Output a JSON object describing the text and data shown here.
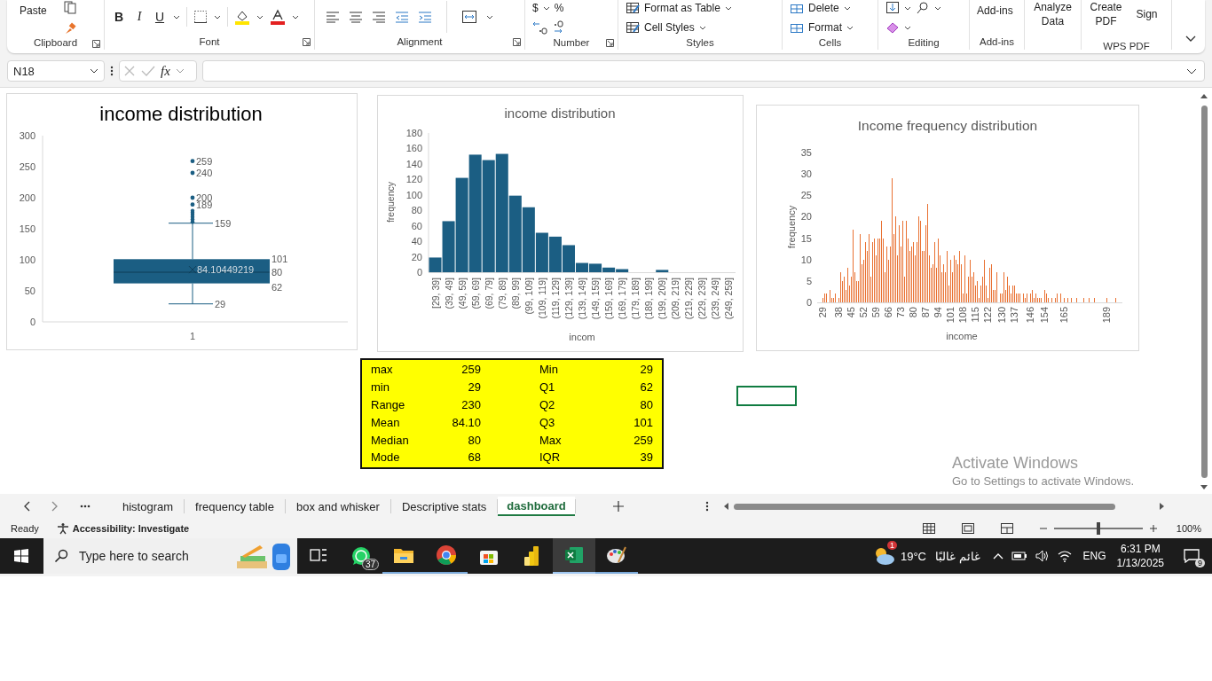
{
  "ribbon": {
    "clipboard": {
      "label": "Clipboard",
      "paste": "Paste"
    },
    "font": {
      "label": "Font",
      "bold": "B",
      "italic": "I",
      "underline": "U"
    },
    "alignment": {
      "label": "Alignment"
    },
    "number": {
      "label": "Number",
      "currency": "$",
      "percent": "%"
    },
    "styles": {
      "label": "Styles",
      "buttons": [
        "Format as Table",
        "Cell Styles"
      ]
    },
    "cells": {
      "label": "Cells",
      "buttons": [
        "Delete",
        "Format"
      ]
    },
    "editing": {
      "label": "Editing"
    },
    "addins": {
      "label": "Add-ins",
      "button": "Add-ins"
    },
    "analyze": {
      "button": "Analyze Data"
    },
    "wps": {
      "label": "WPS PDF",
      "buttons": [
        "Create PDF",
        "Sign"
      ]
    }
  },
  "formula_bar": {
    "name_box": "N18",
    "function_label": "fx"
  },
  "box_plot": {
    "title": "income distribution",
    "yticks": [
      "300",
      "250",
      "200",
      "150",
      "100",
      "50",
      "0"
    ],
    "category": "1",
    "min": "29",
    "q1": "62",
    "median": "80",
    "q3": "101",
    "upper_whisker": "159",
    "mean": "84.10449219",
    "outliers": [
      "259",
      "240",
      "200",
      "189"
    ]
  },
  "histogram": {
    "chart_data": {
      "type": "bar",
      "title": "income distribution",
      "xlabel": "incom",
      "ylabel": "frequency",
      "categories": [
        "[29, 39]",
        "(39, 49]",
        "(49, 59]",
        "(59, 69]",
        "(69, 79]",
        "(79, 89]",
        "(89, 99]",
        "(99, 109]",
        "(109, 119]",
        "(119, 129]",
        "(129, 139]",
        "(139, 149]",
        "(149, 159]",
        "(159, 169]",
        "(169, 179]",
        "(179, 189]",
        "(189, 199]",
        "(199, 209]",
        "(209, 219]",
        "(219, 229]",
        "(229, 239]",
        "(239, 249]",
        "(249, 259]"
      ],
      "series": [
        {
          "color": "#1b5e83",
          "values": [
            19,
            66,
            122,
            152,
            145,
            153,
            99,
            84,
            51,
            46,
            35,
            12,
            11,
            6,
            4,
            0,
            0,
            3,
            0,
            0,
            0,
            0,
            0
          ]
        }
      ],
      "ylim": [
        0,
        180
      ],
      "yticks": [
        0,
        20,
        40,
        60,
        80,
        100,
        120,
        140,
        160,
        180
      ]
    }
  },
  "frequency": {
    "chart_data": {
      "type": "bar",
      "title": "Income frequency distribution",
      "xlabel": "income",
      "ylabel": "frequency",
      "x": [
        29,
        30,
        31,
        33,
        34,
        35,
        36,
        38,
        39,
        40,
        41,
        42,
        43,
        44,
        45,
        46,
        47,
        48,
        49,
        50,
        51,
        52,
        53,
        54,
        55,
        56,
        57,
        58,
        59,
        60,
        61,
        62,
        63,
        64,
        65,
        66,
        67,
        68,
        69,
        70,
        71,
        72,
        73,
        74,
        75,
        76,
        77,
        78,
        79,
        80,
        81,
        82,
        83,
        84,
        85,
        86,
        87,
        88,
        89,
        90,
        91,
        92,
        93,
        94,
        95,
        96,
        97,
        98,
        99,
        100,
        101,
        102,
        103,
        104,
        105,
        106,
        107,
        108,
        109,
        110,
        111,
        112,
        113,
        114,
        115,
        116,
        117,
        118,
        119,
        120,
        121,
        122,
        123,
        124,
        125,
        126,
        127,
        129,
        130,
        131,
        132,
        133,
        134,
        135,
        136,
        137,
        138,
        139,
        140,
        142,
        143,
        144,
        146,
        147,
        148,
        149,
        150,
        151,
        152,
        154,
        155,
        156,
        158,
        160,
        161,
        163,
        165,
        167,
        169,
        172,
        176,
        179,
        182,
        189,
        194
      ],
      "xlim": [
        27,
        197
      ],
      "xticks": [
        29,
        38,
        45,
        52,
        59,
        66,
        73,
        80,
        87,
        94,
        101,
        108,
        115,
        122,
        130,
        137,
        146,
        154,
        165,
        189
      ],
      "series": [
        {
          "color": "#e97132",
          "values": [
            1,
            2,
            2,
            3,
            1,
            1,
            2,
            1,
            7,
            5,
            6,
            3,
            8,
            4,
            6,
            17,
            7,
            5,
            5,
            16,
            9,
            10,
            14,
            12,
            16,
            6,
            14,
            15,
            11,
            15,
            15,
            19,
            15,
            7,
            13,
            10,
            13,
            29,
            16,
            20,
            11,
            18,
            13,
            19,
            6,
            19,
            15,
            12,
            13,
            14,
            11,
            14,
            20,
            19,
            12,
            12,
            18,
            23,
            11,
            8,
            9,
            14,
            8,
            15,
            11,
            7,
            9,
            7,
            12,
            4,
            10,
            7,
            11,
            10,
            9,
            12,
            9,
            2,
            11,
            2,
            6,
            10,
            6,
            7,
            4,
            5,
            1,
            4,
            6,
            10,
            4,
            1,
            8,
            9,
            3,
            3,
            7,
            2,
            2,
            7,
            3,
            6,
            4,
            2,
            4,
            4,
            2,
            2,
            2,
            2,
            1,
            2,
            2,
            3,
            1,
            2,
            1,
            1,
            1,
            3,
            2,
            1,
            1,
            1,
            2,
            2,
            1,
            1,
            1,
            1,
            1,
            1,
            1,
            1,
            1
          ]
        }
      ],
      "ylim": [
        0,
        35
      ],
      "yticks": [
        0,
        5,
        10,
        15,
        20,
        25,
        30,
        35
      ]
    }
  },
  "stats_table": {
    "rows": [
      [
        "max",
        "259",
        "Min",
        "29"
      ],
      [
        "min",
        "29",
        "Q1",
        "62"
      ],
      [
        "Range",
        "230",
        "Q2",
        "80"
      ],
      [
        "Mean",
        "84.10",
        "Q3",
        "101"
      ],
      [
        "Median",
        "80",
        "Max",
        "259"
      ],
      [
        "Mode",
        "68",
        "IQR",
        "39"
      ]
    ]
  },
  "sheet_tabs": [
    {
      "label": "histogram",
      "selected": false
    },
    {
      "label": "frequency table",
      "selected": false
    },
    {
      "label": "box and whisker",
      "selected": false
    },
    {
      "label": "Descriptive stats",
      "selected": false
    },
    {
      "label": "dashboard",
      "selected": true
    }
  ],
  "activation": {
    "title": "Activate Windows",
    "hint": "Go to Settings to activate Windows."
  },
  "status_bar": {
    "mode": "Ready",
    "accessibility": "Accessibility: Investigate",
    "zoom": "100%",
    "zoom_slider": {
      "level": 0.5
    }
  },
  "taskbar": {
    "search_placeholder": "Type here to search",
    "apps": [
      {
        "kind": "taskview",
        "running": false,
        "selected": false
      },
      {
        "kind": "whatsapp",
        "badge": "37",
        "running": false,
        "selected": false
      },
      {
        "kind": "folder",
        "running": true,
        "selected": false
      },
      {
        "kind": "chrome",
        "running": true,
        "selected": false
      },
      {
        "kind": "store",
        "running": false,
        "selected": false
      },
      {
        "kind": "powerbi",
        "running": false,
        "selected": false
      },
      {
        "kind": "excel",
        "running": true,
        "selected": true
      },
      {
        "kind": "paint",
        "running": true,
        "selected": false
      }
    ],
    "weather_badge": "1",
    "temperature": "19°C",
    "weather": "غائم غالبًا",
    "language": "ENG",
    "time": "6:31 PM",
    "date": "1/13/2025",
    "notifications": "9"
  }
}
